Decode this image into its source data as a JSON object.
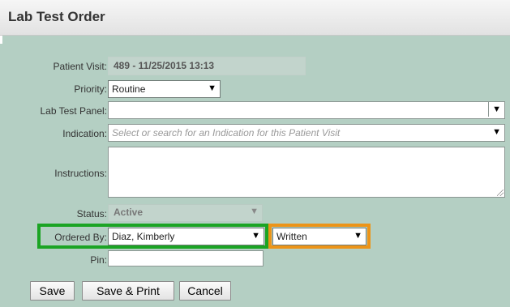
{
  "window": {
    "title": "Lab Test Order"
  },
  "form": {
    "patient_visit": {
      "label": "Patient Visit:",
      "value": "489 - 11/25/2015 13:13"
    },
    "priority": {
      "label": "Priority:",
      "value": "Routine"
    },
    "lab_test_panel": {
      "label": "Lab Test Panel:",
      "value": ""
    },
    "indication": {
      "label": "Indication:",
      "placeholder": "Select or search for an Indication for this Patient Visit"
    },
    "instructions": {
      "label": "Instructions:",
      "value": ""
    },
    "status": {
      "label": "Status:",
      "value": "Active"
    },
    "ordered_by": {
      "label": "Ordered By:",
      "value": "Diaz, Kimberly"
    },
    "order_type": {
      "value": "Written"
    },
    "pin": {
      "label": "Pin:",
      "value": ""
    }
  },
  "buttons": {
    "save": "Save",
    "save_print": "Save & Print",
    "cancel": "Cancel"
  },
  "icons": {
    "dropdown": "▼"
  },
  "colors": {
    "background": "#b4cfc3",
    "highlight_ordered_by": "#1ba424",
    "highlight_order_type": "#ec9418"
  }
}
